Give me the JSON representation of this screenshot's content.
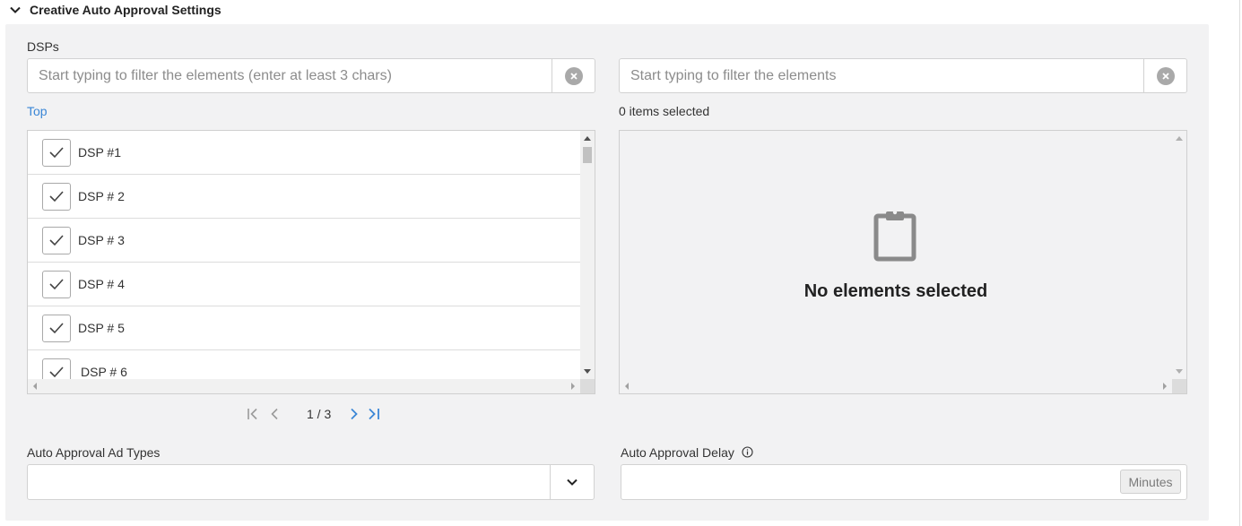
{
  "section": {
    "title": "Creative Auto Approval Settings"
  },
  "dsps": {
    "label": "DSPs",
    "available_filter_placeholder": "Start typing to filter the elements (enter at least 3 chars)",
    "selected_filter_placeholder": "Start typing to filter the elements",
    "top_link": "Top",
    "selected_count": "0 items selected",
    "items": [
      {
        "label": "DSP #1",
        "checked": true
      },
      {
        "label": "DSP # 2",
        "checked": true
      },
      {
        "label": "DSP # 3",
        "checked": true
      },
      {
        "label": "DSP # 4",
        "checked": true
      },
      {
        "label": "DSP # 5",
        "checked": true
      },
      {
        "label": "DSP # 6",
        "checked": true
      }
    ],
    "empty_message": "No elements selected",
    "pagination": {
      "text": "1 / 3"
    }
  },
  "ad_types": {
    "label": "Auto Approval Ad Types",
    "value": ""
  },
  "delay": {
    "label": "Auto Approval Delay",
    "value": "",
    "unit": "Minutes"
  },
  "colors": {
    "accent": "#3a86d6",
    "panel_bg": "#f2f2f3",
    "icon_gray": "#8a8a8a"
  }
}
